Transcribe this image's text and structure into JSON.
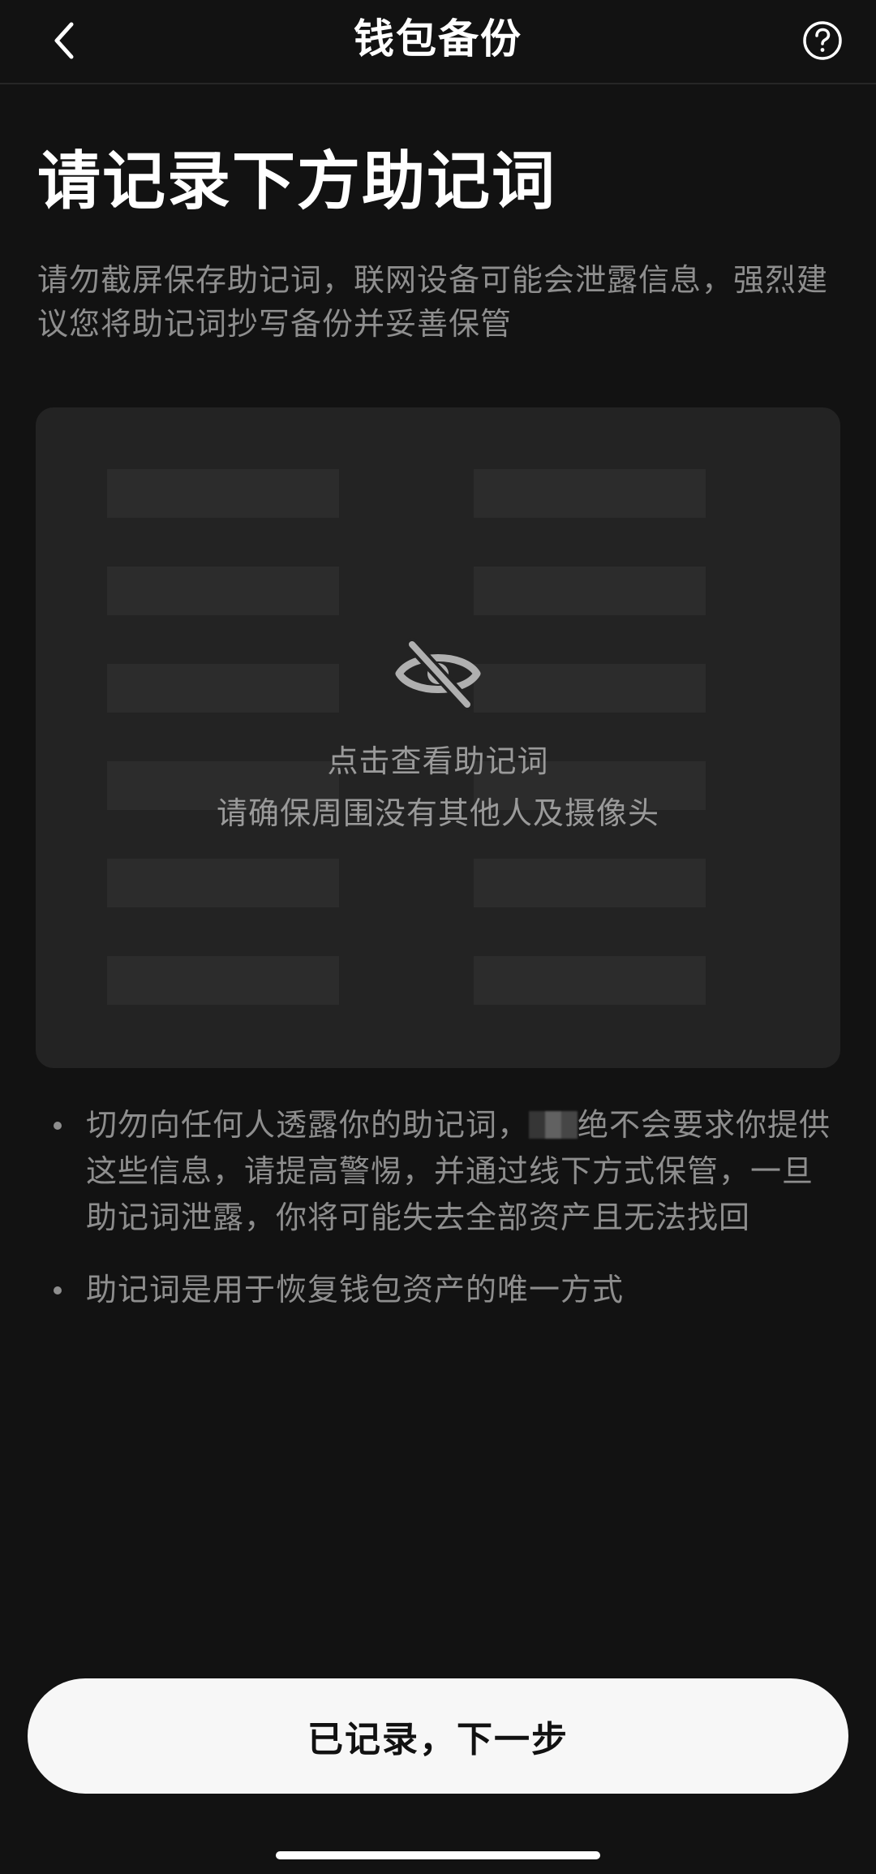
{
  "header": {
    "title": "钱包备份",
    "back_icon": "chevron-left-icon",
    "help_icon": "question-circle-icon"
  },
  "main": {
    "title": "请记录下方助记词",
    "subtitle": "请勿截屏保存助记词，联网设备可能会泄露信息，强烈建议您将助记词抄写备份并妥善保管"
  },
  "phrase_card": {
    "hidden_icon": "eye-slash-icon",
    "reveal_title": "点击查看助记词",
    "reveal_subtitle": "请确保周围没有其他人及摄像头"
  },
  "warnings": {
    "item1_before": "切勿向任何人透露你的助记词，",
    "item1_redacted_brand": "",
    "item1_after": "绝不会要求你提供这些信息，请提高警惕，并通过线下方式保管，一旦助记词泄露，你将可能失去全部资产且无法找回",
    "item2": "助记词是用于恢复钱包资产的唯一方式"
  },
  "footer": {
    "next_button_label": "已记录，下一步"
  },
  "colors": {
    "background": "#121212",
    "card": "#232323",
    "word_slot": "#2c2c2c",
    "muted_text": "#8e8e8e",
    "button_bg": "#f7f7f7",
    "button_text": "#111111"
  }
}
